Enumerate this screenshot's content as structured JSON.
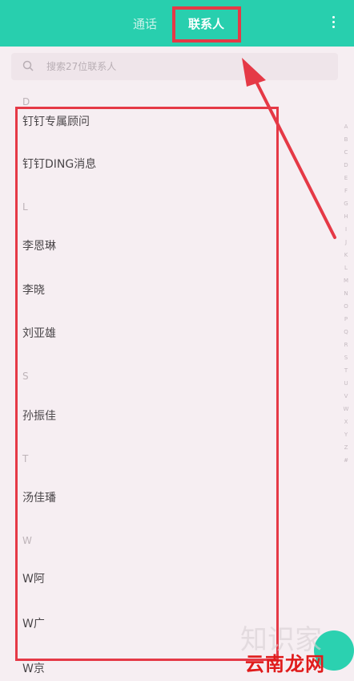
{
  "tabs": {
    "calls": "通话",
    "contacts": "联系人"
  },
  "search": {
    "placeholder": "搜索27位联系人"
  },
  "sections": [
    {
      "letter": "D",
      "items": [
        "钉钉专属顾问",
        "钉钉DING消息"
      ]
    },
    {
      "letter": "L",
      "items": [
        "李恩琳",
        "李晓",
        "刘亚雄"
      ]
    },
    {
      "letter": "S",
      "items": [
        "孙振佳"
      ]
    },
    {
      "letter": "T",
      "items": [
        "汤佳璠"
      ]
    },
    {
      "letter": "W",
      "items": [
        "W阿",
        "W广",
        "W京"
      ]
    }
  ],
  "index_letters": [
    "A",
    "B",
    "C",
    "D",
    "E",
    "F",
    "G",
    "H",
    "I",
    "J",
    "K",
    "L",
    "M",
    "N",
    "O",
    "P",
    "Q",
    "R",
    "S",
    "T",
    "U",
    "V",
    "W",
    "X",
    "Y",
    "Z",
    "#"
  ],
  "watermark": {
    "faint": "知识家",
    "brand": "云南龙网"
  },
  "colors": {
    "accent": "#28cfae",
    "annotation": "#e53946"
  }
}
